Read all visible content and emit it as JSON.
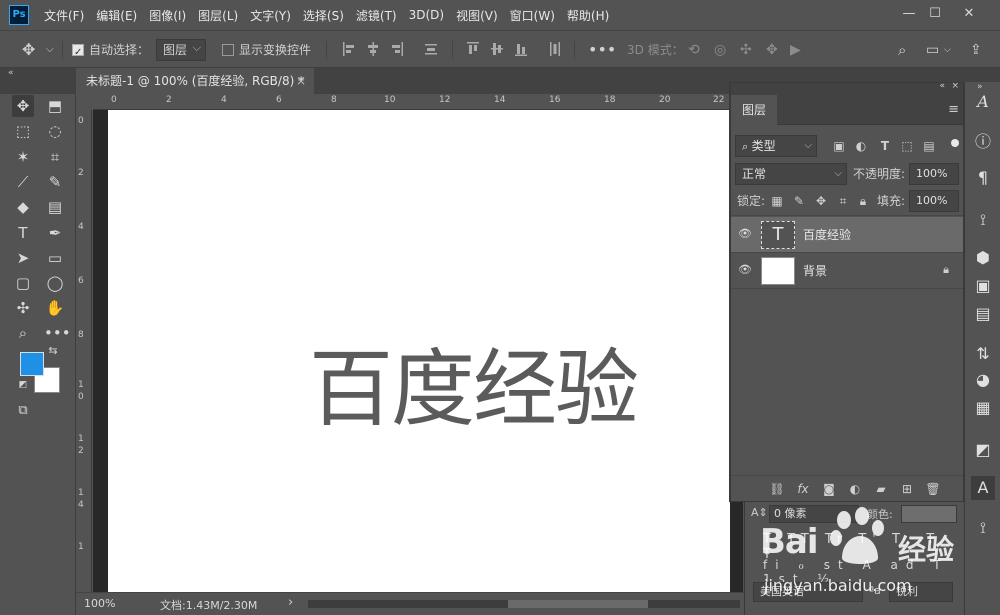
{
  "app": {
    "logo": "Ps"
  },
  "menubar": {
    "items": [
      "文件(F)",
      "编辑(E)",
      "图像(I)",
      "图层(L)",
      "文字(Y)",
      "选择(S)",
      "滤镜(T)",
      "3D(D)",
      "视图(V)",
      "窗口(W)",
      "帮助(H)"
    ]
  },
  "window_controls": {
    "minimize": "—",
    "maximize": "☐",
    "close": "✕"
  },
  "options": {
    "auto_select_label": "自动选择：",
    "auto_select_value": "图层",
    "show_transform_label": "显示变换控件",
    "mode_3d_label": "3D 模式："
  },
  "document_tab": {
    "title": "未标题-1 @ 100% (百度经验, RGB/8) *",
    "close": "×"
  },
  "ruler": {
    "h_labels": [
      "0",
      "2",
      "4",
      "6",
      "8",
      "10",
      "12",
      "14",
      "16",
      "18",
      "20",
      "22"
    ],
    "v_labels": [
      "0",
      "2",
      "4",
      "6",
      "8",
      "1",
      "0",
      "1",
      "2",
      "1",
      "4",
      "1"
    ]
  },
  "canvas": {
    "text": "百度经验",
    "text_color": "#5b5b5b"
  },
  "status": {
    "zoom": "100%",
    "doc_info": "文档:1.43M/2.30M",
    "arrow": "›"
  },
  "layers_panel": {
    "tab_label": "图层",
    "filter_kind": "类型",
    "blend_mode": "正常",
    "opacity_label": "不透明度:",
    "opacity_value": "100%",
    "lock_label": "锁定:",
    "fill_label": "填充:",
    "fill_value": "100%",
    "layers": [
      {
        "name": "百度经验",
        "type": "text",
        "selected": true
      },
      {
        "name": "背景",
        "type": "background",
        "locked": true
      }
    ],
    "footer_fx": "fx"
  },
  "character_panel": {
    "size_value": "0 像素",
    "color_label": "颜色:",
    "language": "美国英语",
    "antialias": "锐利"
  },
  "watermark": {
    "brand": "Bai",
    "brand2": "经验",
    "url": "jingyan.baidu.com"
  },
  "colors": {
    "foreground": "#1e90e5",
    "background": "#ffffff",
    "ui_bg": "#535353",
    "accent": "#31a8ff"
  }
}
